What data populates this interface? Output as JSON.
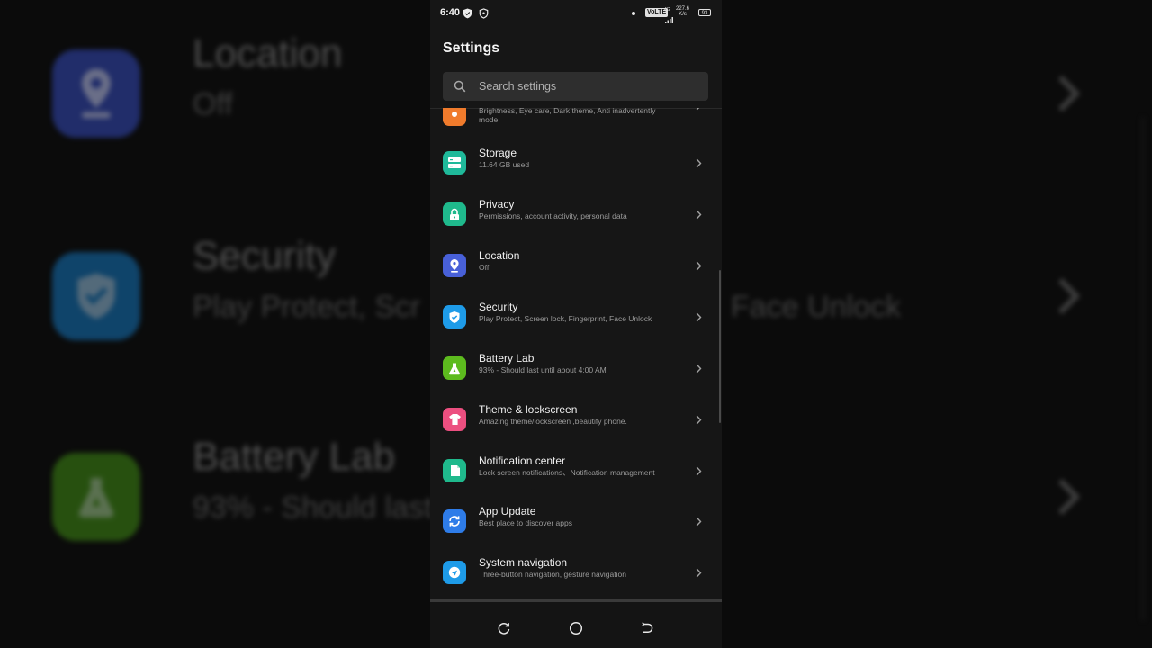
{
  "status_bar": {
    "time": "6:40",
    "volte": "VoLTE",
    "network": "4G",
    "speed_value": "227.6",
    "speed_unit": "K/s",
    "battery": "93"
  },
  "header": {
    "title": "Settings"
  },
  "search": {
    "placeholder": "Search settings"
  },
  "items": [
    {
      "title": "",
      "subtitle_line1": "Brightness, Eye care, Dark theme, Anti inadvertently",
      "subtitle_line2": "mode",
      "icon": "display-icon",
      "color": "#F07B2C"
    },
    {
      "title": "Storage",
      "subtitle": "11.64 GB used",
      "icon": "storage-icon",
      "color": "#1FB99A"
    },
    {
      "title": "Privacy",
      "subtitle": "Permissions, account activity, personal data",
      "icon": "lock-icon",
      "color": "#1FB98C"
    },
    {
      "title": "Location",
      "subtitle": "Off",
      "icon": "location-pin-icon",
      "color": "#4860D8"
    },
    {
      "title": "Security",
      "subtitle": "Play Protect, Screen lock, Fingerprint, Face Unlock",
      "icon": "shield-check-icon",
      "color": "#1E9BE8"
    },
    {
      "title": "Battery Lab",
      "subtitle": "93% - Should last until about 4:00 AM",
      "icon": "flask-icon",
      "color": "#5DBB1E"
    },
    {
      "title": "Theme & lockscreen",
      "subtitle": "Amazing theme/lockscreen ,beautify phone.",
      "icon": "shirt-icon",
      "color": "#EC4F80"
    },
    {
      "title": "Notification center",
      "subtitle": "Lock screen notifications、Notification management",
      "icon": "notification-icon",
      "color": "#1FB98C"
    },
    {
      "title": "App Update",
      "subtitle": "Best place to discover apps",
      "icon": "refresh-icon",
      "color": "#2E7CE8"
    },
    {
      "title": "System navigation",
      "subtitle": "Three-button navigation, gesture navigation",
      "icon": "navigation-icon",
      "color": "#1E9BE8"
    }
  ],
  "background": {
    "location": {
      "title": "Location",
      "subtitle": "Off"
    },
    "security": {
      "title": "Security",
      "subtitle_left": "Play Protect, Scr",
      "subtitle_right": "Face Unlock"
    },
    "battery": {
      "title": "Battery Lab",
      "subtitle": "93% - Should last"
    }
  },
  "nav": {
    "buttons": [
      "recents",
      "home",
      "back"
    ]
  }
}
